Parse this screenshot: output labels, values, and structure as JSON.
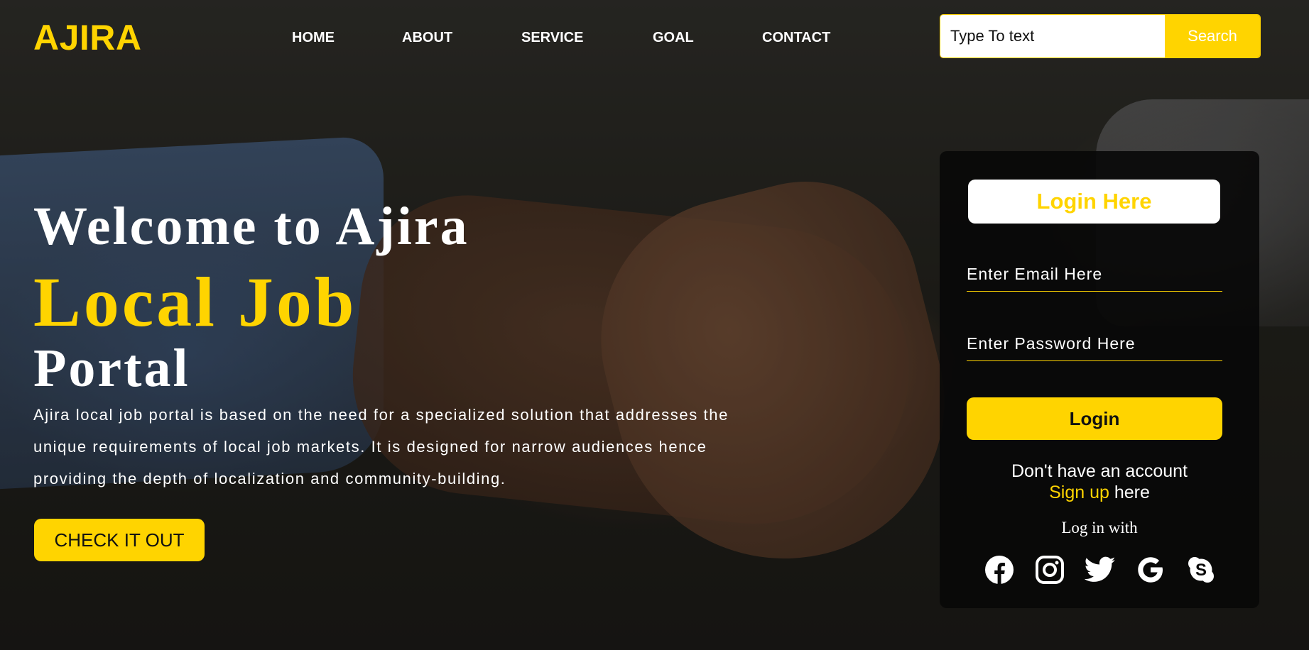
{
  "header": {
    "logo": "AJIRA",
    "nav": [
      {
        "label": "HOME"
      },
      {
        "label": "ABOUT"
      },
      {
        "label": "SERVICE"
      },
      {
        "label": "GOAL"
      },
      {
        "label": "CONTACT"
      }
    ],
    "search": {
      "placeholder": "Type To text",
      "button_label": "Search"
    }
  },
  "hero": {
    "title": "Welcome to Ajira",
    "accent": "Local Job",
    "subtitle": "Portal",
    "description": "Ajira local job portal is based on the need for a specialized solution that addresses the unique requirements of local job markets. It is designed for narrow audiences hence providing the depth of localization and community-building.",
    "cta_label": "CHECK IT OUT"
  },
  "login": {
    "heading": "Login Here",
    "email_placeholder": "Enter Email Here",
    "password_placeholder": "Enter Password Here",
    "button_label": "Login",
    "signup_prompt": "Don't have an account",
    "signup_link": "Sign up",
    "signup_suffix": " here",
    "login_with": "Log in with",
    "social": [
      {
        "icon": "facebook-icon"
      },
      {
        "icon": "instagram-icon"
      },
      {
        "icon": "twitter-icon"
      },
      {
        "icon": "google-icon"
      },
      {
        "icon": "skype-icon"
      }
    ]
  },
  "colors": {
    "accent": "#ffd400",
    "text": "#ffffff",
    "card": "#080808"
  }
}
